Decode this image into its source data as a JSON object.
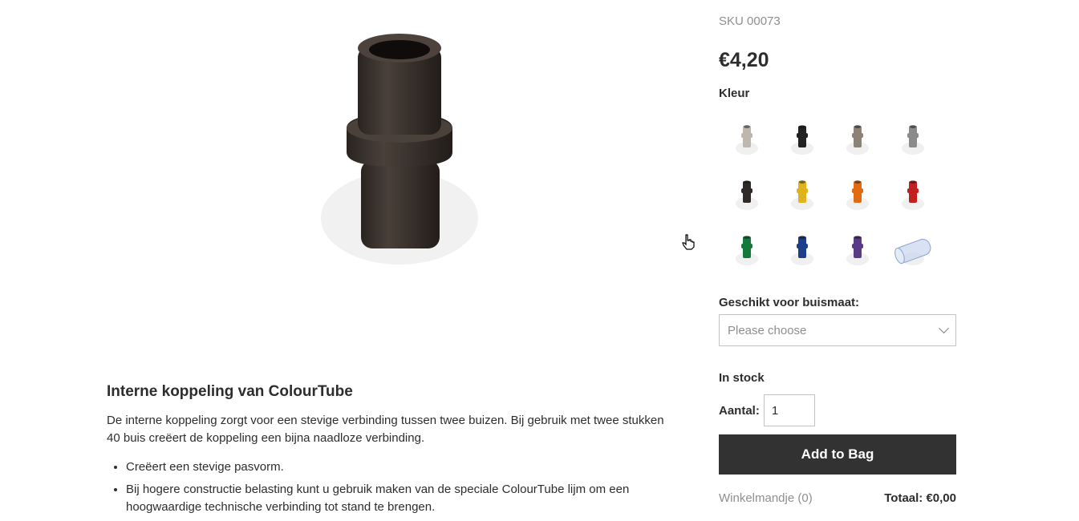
{
  "product": {
    "sku": "SKU 00073",
    "price": "€4,20",
    "main_color": "#3a322d"
  },
  "colour": {
    "label": "Kleur",
    "swatches": [
      {
        "name": "swatch-light-grey",
        "color": "#bdb7ae"
      },
      {
        "name": "swatch-black",
        "color": "#222222"
      },
      {
        "name": "swatch-taupe",
        "color": "#8c8276"
      },
      {
        "name": "swatch-grey",
        "color": "#8b8b8b"
      },
      {
        "name": "swatch-dark-brown",
        "color": "#2f2a27"
      },
      {
        "name": "swatch-yellow",
        "color": "#e0b31b"
      },
      {
        "name": "swatch-orange",
        "color": "#e26a12"
      },
      {
        "name": "swatch-red",
        "color": "#c21f1f"
      },
      {
        "name": "swatch-green",
        "color": "#147a3c"
      },
      {
        "name": "swatch-blue",
        "color": "#1d3f8a"
      },
      {
        "name": "swatch-purple",
        "color": "#5a3b86"
      },
      {
        "name": "swatch-transparent",
        "color": "#c7d6ee"
      }
    ]
  },
  "size": {
    "label": "Geschikt voor buismaat:",
    "placeholder": "Please choose"
  },
  "stock": {
    "status": "In stock",
    "qty_label": "Aantal:",
    "qty_value": "1"
  },
  "actions": {
    "add_to_bag": "Add to Bag"
  },
  "bag": {
    "link": "Winkelmandje (0)",
    "total": "Totaal: €0,00"
  },
  "description": {
    "title": "Interne koppeling van ColourTube",
    "text": "De interne koppeling zorgt voor een stevige verbinding tussen twee buizen. Bij gebruik met twee stukken 40 buis creëert de koppeling een bijna naadloze verbinding.",
    "bullets": [
      "Creëert een stevige pasvorm.",
      "Bij hogere constructie belasting kunt u gebruik maken van de speciale ColourTube lijm om een hoogwaardige technische verbinding tot stand te brengen."
    ]
  }
}
